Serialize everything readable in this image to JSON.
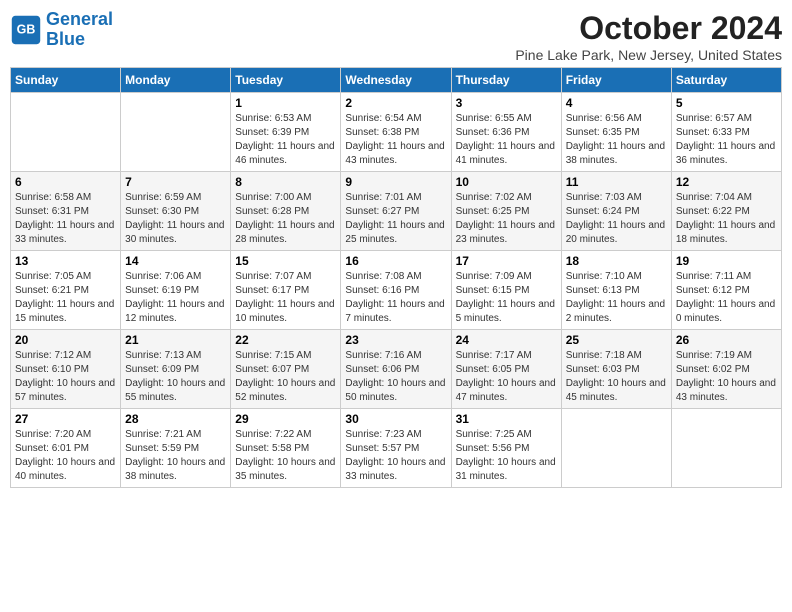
{
  "header": {
    "logo_line1": "General",
    "logo_line2": "Blue",
    "title": "October 2024",
    "subtitle": "Pine Lake Park, New Jersey, United States"
  },
  "weekdays": [
    "Sunday",
    "Monday",
    "Tuesday",
    "Wednesday",
    "Thursday",
    "Friday",
    "Saturday"
  ],
  "weeks": [
    [
      {
        "day": "",
        "info": ""
      },
      {
        "day": "",
        "info": ""
      },
      {
        "day": "1",
        "info": "Sunrise: 6:53 AM\nSunset: 6:39 PM\nDaylight: 11 hours and 46 minutes."
      },
      {
        "day": "2",
        "info": "Sunrise: 6:54 AM\nSunset: 6:38 PM\nDaylight: 11 hours and 43 minutes."
      },
      {
        "day": "3",
        "info": "Sunrise: 6:55 AM\nSunset: 6:36 PM\nDaylight: 11 hours and 41 minutes."
      },
      {
        "day": "4",
        "info": "Sunrise: 6:56 AM\nSunset: 6:35 PM\nDaylight: 11 hours and 38 minutes."
      },
      {
        "day": "5",
        "info": "Sunrise: 6:57 AM\nSunset: 6:33 PM\nDaylight: 11 hours and 36 minutes."
      }
    ],
    [
      {
        "day": "6",
        "info": "Sunrise: 6:58 AM\nSunset: 6:31 PM\nDaylight: 11 hours and 33 minutes."
      },
      {
        "day": "7",
        "info": "Sunrise: 6:59 AM\nSunset: 6:30 PM\nDaylight: 11 hours and 30 minutes."
      },
      {
        "day": "8",
        "info": "Sunrise: 7:00 AM\nSunset: 6:28 PM\nDaylight: 11 hours and 28 minutes."
      },
      {
        "day": "9",
        "info": "Sunrise: 7:01 AM\nSunset: 6:27 PM\nDaylight: 11 hours and 25 minutes."
      },
      {
        "day": "10",
        "info": "Sunrise: 7:02 AM\nSunset: 6:25 PM\nDaylight: 11 hours and 23 minutes."
      },
      {
        "day": "11",
        "info": "Sunrise: 7:03 AM\nSunset: 6:24 PM\nDaylight: 11 hours and 20 minutes."
      },
      {
        "day": "12",
        "info": "Sunrise: 7:04 AM\nSunset: 6:22 PM\nDaylight: 11 hours and 18 minutes."
      }
    ],
    [
      {
        "day": "13",
        "info": "Sunrise: 7:05 AM\nSunset: 6:21 PM\nDaylight: 11 hours and 15 minutes."
      },
      {
        "day": "14",
        "info": "Sunrise: 7:06 AM\nSunset: 6:19 PM\nDaylight: 11 hours and 12 minutes."
      },
      {
        "day": "15",
        "info": "Sunrise: 7:07 AM\nSunset: 6:17 PM\nDaylight: 11 hours and 10 minutes."
      },
      {
        "day": "16",
        "info": "Sunrise: 7:08 AM\nSunset: 6:16 PM\nDaylight: 11 hours and 7 minutes."
      },
      {
        "day": "17",
        "info": "Sunrise: 7:09 AM\nSunset: 6:15 PM\nDaylight: 11 hours and 5 minutes."
      },
      {
        "day": "18",
        "info": "Sunrise: 7:10 AM\nSunset: 6:13 PM\nDaylight: 11 hours and 2 minutes."
      },
      {
        "day": "19",
        "info": "Sunrise: 7:11 AM\nSunset: 6:12 PM\nDaylight: 11 hours and 0 minutes."
      }
    ],
    [
      {
        "day": "20",
        "info": "Sunrise: 7:12 AM\nSunset: 6:10 PM\nDaylight: 10 hours and 57 minutes."
      },
      {
        "day": "21",
        "info": "Sunrise: 7:13 AM\nSunset: 6:09 PM\nDaylight: 10 hours and 55 minutes."
      },
      {
        "day": "22",
        "info": "Sunrise: 7:15 AM\nSunset: 6:07 PM\nDaylight: 10 hours and 52 minutes."
      },
      {
        "day": "23",
        "info": "Sunrise: 7:16 AM\nSunset: 6:06 PM\nDaylight: 10 hours and 50 minutes."
      },
      {
        "day": "24",
        "info": "Sunrise: 7:17 AM\nSunset: 6:05 PM\nDaylight: 10 hours and 47 minutes."
      },
      {
        "day": "25",
        "info": "Sunrise: 7:18 AM\nSunset: 6:03 PM\nDaylight: 10 hours and 45 minutes."
      },
      {
        "day": "26",
        "info": "Sunrise: 7:19 AM\nSunset: 6:02 PM\nDaylight: 10 hours and 43 minutes."
      }
    ],
    [
      {
        "day": "27",
        "info": "Sunrise: 7:20 AM\nSunset: 6:01 PM\nDaylight: 10 hours and 40 minutes."
      },
      {
        "day": "28",
        "info": "Sunrise: 7:21 AM\nSunset: 5:59 PM\nDaylight: 10 hours and 38 minutes."
      },
      {
        "day": "29",
        "info": "Sunrise: 7:22 AM\nSunset: 5:58 PM\nDaylight: 10 hours and 35 minutes."
      },
      {
        "day": "30",
        "info": "Sunrise: 7:23 AM\nSunset: 5:57 PM\nDaylight: 10 hours and 33 minutes."
      },
      {
        "day": "31",
        "info": "Sunrise: 7:25 AM\nSunset: 5:56 PM\nDaylight: 10 hours and 31 minutes."
      },
      {
        "day": "",
        "info": ""
      },
      {
        "day": "",
        "info": ""
      }
    ]
  ]
}
